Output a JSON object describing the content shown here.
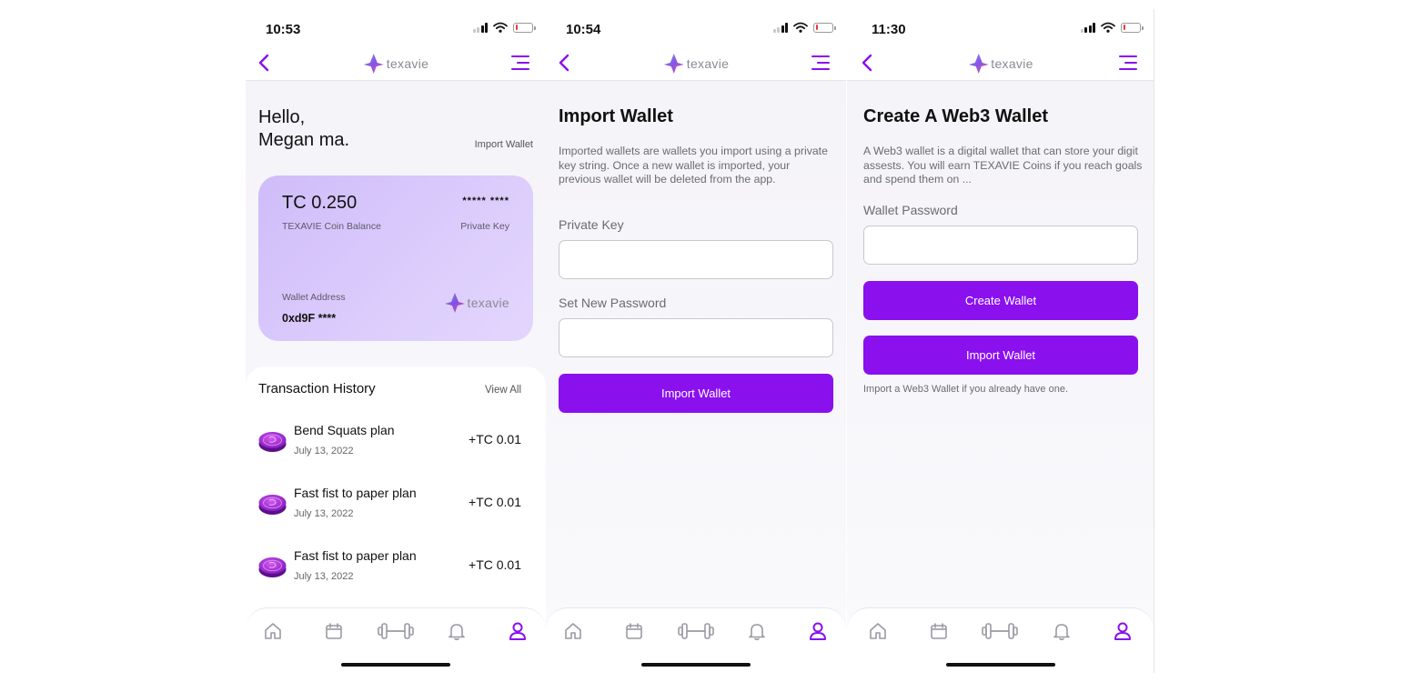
{
  "colors": {
    "accent": "#8a10ee",
    "card": "#d8c8fb",
    "battery_low": "#e53935"
  },
  "screen1": {
    "time": "10:53",
    "logo_text": "texavie",
    "greeting_line1": "Hello,",
    "greeting_line2": "Megan ma.",
    "import_wallet_link": "Import Wallet",
    "card": {
      "balance": "TC 0.250",
      "balance_label": "TEXAVIE Coin Balance",
      "private_key": "***** ****",
      "private_key_label": "Private Key",
      "wallet_address_label": "Wallet Address",
      "wallet_address": "0xd9F ****",
      "logo_text": "texavie"
    },
    "transactions": {
      "title": "Transaction History",
      "view_all": "View All",
      "items": [
        {
          "name": "Bend Squats plan",
          "date": "July 13, 2022",
          "amount": "+TC 0.01"
        },
        {
          "name": "Fast fist to paper plan",
          "date": "July 13, 2022",
          "amount": "+TC 0.01"
        },
        {
          "name": "Fast fist to paper plan",
          "date": "July 13, 2022",
          "amount": "+TC 0.01"
        }
      ]
    }
  },
  "screen2": {
    "time": "10:54",
    "logo_text": "texavie",
    "title": "Import Wallet",
    "description": "Imported wallets are wallets you import using a private key string. Once a new wallet is imported, your previous wallet will be deleted from the app.",
    "private_key_label": "Private Key",
    "password_label": "Set New Password",
    "import_button": "Import Wallet"
  },
  "screen3": {
    "time": "11:30",
    "logo_text": "texavie",
    "title": "Create A Web3 Wallet",
    "description": "A Web3 wallet is a digital wallet that can store your digit assests. You will earn TEXAVIE Coins if you reach goals and spend them on ...",
    "password_label": "Wallet Password",
    "create_button": "Create Wallet",
    "import_button": "Import Wallet",
    "hint": "Import a Web3 Wallet if you already have one."
  },
  "tabbar": {
    "tabs": [
      "home-icon",
      "calendar-icon",
      "dumbbell-icon",
      "bell-icon",
      "profile-icon"
    ],
    "active": "profile-icon"
  }
}
